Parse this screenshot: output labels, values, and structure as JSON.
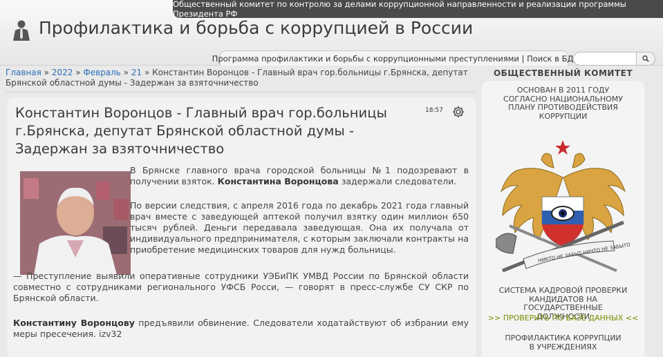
{
  "topbar": {
    "text": "Общественный комитет по контролю за делами коррупционной направленности и реализации программы Президента РФ"
  },
  "header": {
    "site_title": "Профилактика и борьба с коррупцией в России",
    "subnav": "Программа профилактики и борьбы с коррупционными преступлениями | Поиск в БД:",
    "search_placeholder": ""
  },
  "breadcrumb": {
    "home": "Главная",
    "sep1": " » ",
    "year": "2022",
    "sep2": " » ",
    "month": "Февраль",
    "sep3": " » ",
    "day": "21",
    "rest": " » Константин Воронцов - Главный врач гор.больницы г.Брянска, депутат Брянской областной думы - Задержан за взяточничество"
  },
  "article": {
    "title": "Константин Воронцов - Главный врач гор.больницы г.Брянска, депутат Брянской областной думы - Задержан за взяточничество",
    "time": "18:57",
    "p1_a": "В Брянске главного врача городской больницы №1 подозревают в получении взяток. ",
    "p1_b": "Константина Воронцова",
    "p1_c": " задержали следователи.",
    "p2": "По версии следствия, с апреля 2016 года по декабрь 2021 года главный врач вместе с заведующей аптекой получил взятку один миллион 650 тысяч рублей. Деньги передавала заведующая. Она их получала от индивидуального предпринимателя, с которым заключали контракты на приобретение медицинских товаров для нужд больницы.",
    "p3": "— Преступление выявили оперативные сотрудники УЭБиПК УМВД России по Брянской области совместно с сотрудниками регионального УФСБ Росси, — говорят в пресс-службе СУ СКР по Брянской области.",
    "p4_a": "Константину Воронцову",
    "p4_b": " предъявили обвинение. Следователи ходатайствуют об избрании ему меры пресечения. izv32"
  },
  "sidebar": {
    "title": "ОБЩЕСТВЕННЫЙ КОМИТЕТ",
    "founded": "ОСНОВАН В 2011 ГОДУ СОГЛАСНО НАЦИОНАЛЬНОМУ ПЛАНУ ПРОТИВОДЕЙСТВИЯ КОРРУПЦИИ",
    "emblem_ribbon": "НИКТО НЕ ЗАБЫТ НИЧТО НЕ ЗАБЫТО",
    "check_system": "СИСТЕМА КАДРОВОЙ ПРОВЕРКИ КАНДИДАТОВ НА ГОСУДАРСТВЕННЫЕ ДОЛЖНОСТИ",
    "check_link": ">> ПРОВЕРИТЬ ПО БАЗЕ ДАННЫХ <<",
    "prevention": "ПРОФИЛАКТИКА КОРРУПЦИИ В УЧРЕЖДЕНИЯХ"
  },
  "colors": {
    "link": "#2a6fb8",
    "topbar": "#4a4a4a",
    "sidebar_link": "#7a8a00"
  }
}
